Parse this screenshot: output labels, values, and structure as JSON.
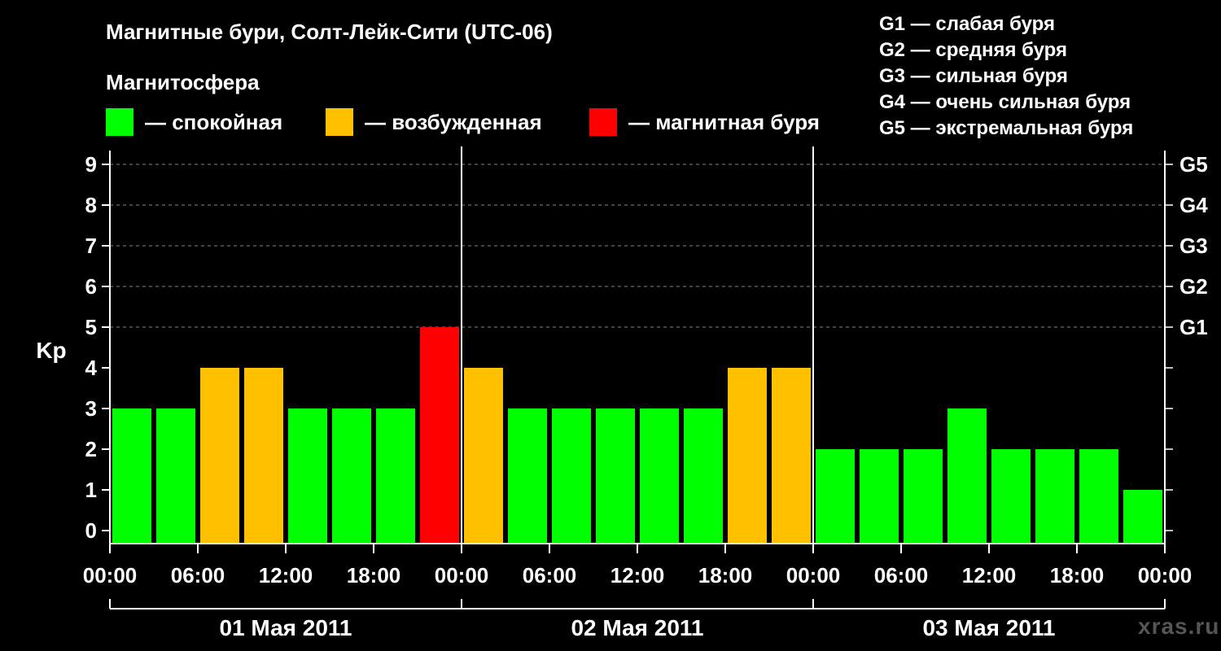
{
  "title": "Магнитные бури, Солт-Лейк-Сити (UTC-06)",
  "subtitle": "Магнитосфера",
  "legend": [
    {
      "color": "#00ff00",
      "label": "— спокойная"
    },
    {
      "color": "#ffc000",
      "label": "— возбужденная"
    },
    {
      "color": "#ff0000",
      "label": "— магнитная буря"
    }
  ],
  "g_legend": [
    "G1 — слабая буря",
    "G2 — средняя буря",
    "G3 — сильная буря",
    "G4 — очень сильная буря",
    "G5 — экстремальная буря"
  ],
  "watermark": "xras.ru",
  "chart_data": {
    "type": "bar",
    "ylabel": "Kp",
    "ylim": [
      0,
      9
    ],
    "y_ticks": [
      "0",
      "1",
      "2",
      "3",
      "4",
      "5",
      "6",
      "7",
      "8",
      "9"
    ],
    "right_ticks": [
      {
        "value": 5,
        "label": "G1"
      },
      {
        "value": 6,
        "label": "G2"
      },
      {
        "value": 7,
        "label": "G3"
      },
      {
        "value": 8,
        "label": "G4"
      },
      {
        "value": 9,
        "label": "G5"
      }
    ],
    "grid": "dashed at Kp 5–9",
    "x_tick_labels": [
      "00:00",
      "06:00",
      "12:00",
      "18:00",
      "00:00",
      "06:00",
      "12:00",
      "18:00",
      "00:00",
      "06:00",
      "12:00",
      "18:00",
      "00:00"
    ],
    "days": [
      "01 Мая 2011",
      "02 Мая 2011",
      "03 Мая 2011"
    ],
    "interval_hours": 3,
    "values": [
      3,
      3,
      4,
      4,
      3,
      3,
      3,
      5,
      4,
      3,
      3,
      3,
      3,
      3,
      4,
      4,
      2,
      2,
      2,
      3,
      2,
      2,
      2,
      1
    ],
    "colors": {
      "quiet": "#00ff00",
      "active": "#ffc000",
      "storm": "#ff0000"
    }
  }
}
